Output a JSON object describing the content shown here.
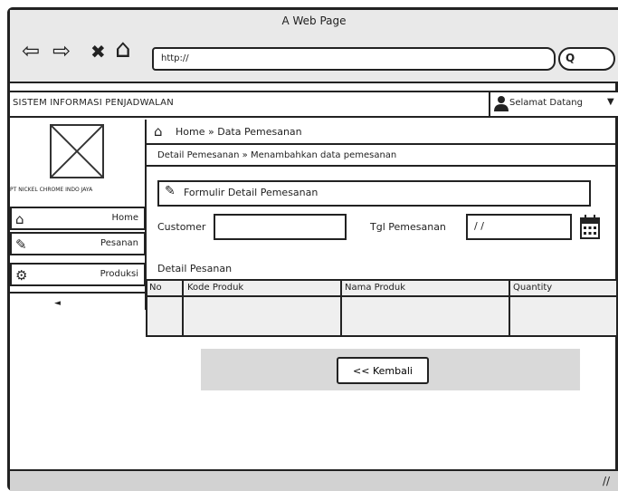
{
  "browser": {
    "window_title": "A Web Page",
    "url": "http://",
    "nav": {
      "back": "⇦",
      "forward": "⇨",
      "stop": "✖",
      "home": "⌂"
    },
    "search_glyph": "Q"
  },
  "app": {
    "title": "SISTEM INFORMASI PENJADWALAN",
    "user_menu": "Selamat Datang",
    "user_caret": "▼"
  },
  "sidebar": {
    "company": "PT NICKEL CHROME INDO JAYA",
    "items": [
      {
        "label": "Home",
        "icon": "home-icon",
        "glyph": "⌂"
      },
      {
        "label": "Pesanan",
        "icon": "edit-icon",
        "glyph": "✎"
      },
      {
        "label": "Produksi",
        "icon": "gears-icon",
        "glyph": "⚙"
      }
    ],
    "collapse_glyph": "◄"
  },
  "breadcrumb": {
    "home": "Home",
    "sep": "»",
    "current": "Data Pemesanan",
    "line": "Detail Pemesanan » Menambahkan data pemesanan"
  },
  "form": {
    "title": "Formulir Detail Pemesanan",
    "customer_label": "Customer",
    "customer_value": "",
    "tgl_label": "Tgl Pemesanan",
    "tgl_value": "/ /",
    "detail_label": "Detail Pesanan"
  },
  "table": {
    "columns": [
      "No",
      "Kode Produk",
      "Nama Produk",
      "Quantity"
    ]
  },
  "actions": {
    "back": "<< Kembali"
  }
}
